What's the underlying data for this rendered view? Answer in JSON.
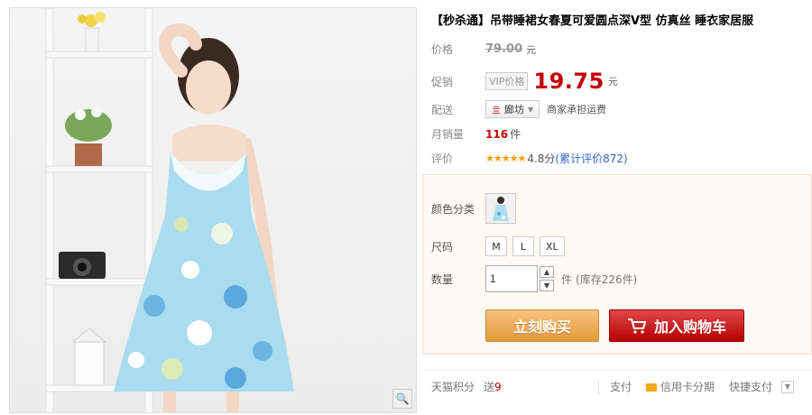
{
  "product": {
    "title": "【秒杀通】吊带睡裙女春夏可爱圆点深V型 仿真丝 睡衣家居服"
  },
  "price": {
    "label": "价格",
    "original": "79.00",
    "unit": "元"
  },
  "promo": {
    "label": "促销",
    "vip_tag": "VIP价格",
    "price": "19.75",
    "unit": "元"
  },
  "shipping": {
    "label": "配送",
    "location_icon": "delivery-icon",
    "location": "廊坊",
    "note": "商家承担运费"
  },
  "sales": {
    "label": "月销量",
    "count": "116",
    "unit": "件"
  },
  "rating": {
    "label": "评价",
    "stars": "★★★★★",
    "score": "4.8分",
    "reviews_link": "(累计评价872)"
  },
  "sku": {
    "color_label": "颜色分类",
    "size_label": "尺码",
    "sizes": [
      "M",
      "L",
      "XL"
    ],
    "qty_label": "数量",
    "qty_value": "1",
    "qty_unit": "件",
    "stock": "(库存226件)"
  },
  "actions": {
    "buy_now": "立刻购买",
    "add_cart": "加入购物车"
  },
  "footer": {
    "points_label": "天猫积分",
    "points_prefix": "送",
    "points_value": "9",
    "pay_label": "支付",
    "installment": "信用卡分期",
    "quick_pay": "快捷支付"
  },
  "colors": {
    "promo_red": "#c40000",
    "buy_orange": "#e39a3b",
    "cart_red": "#b30000",
    "link_blue": "#3366cc"
  }
}
